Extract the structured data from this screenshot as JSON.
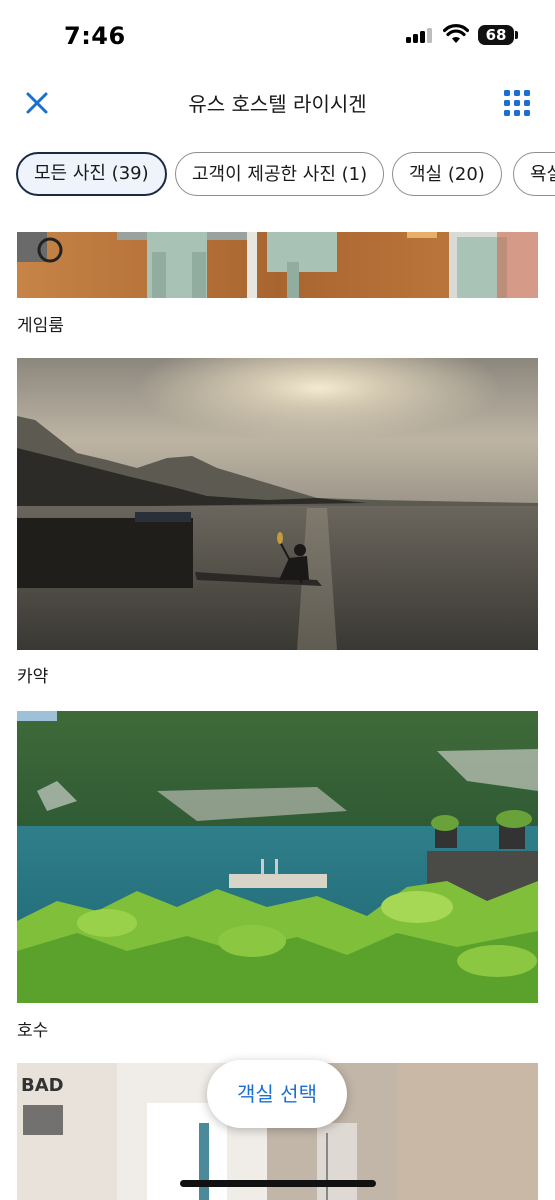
{
  "status": {
    "time": "7:46",
    "battery": "68"
  },
  "header": {
    "title": "유스 호스텔 라이시겐"
  },
  "chips": [
    {
      "label": "모든 사진 (39)"
    },
    {
      "label": "고객이 제공한 사진 (1)"
    },
    {
      "label": "객실 (20)"
    },
    {
      "label": "욕실"
    }
  ],
  "photos": [
    {
      "caption": "게임룸"
    },
    {
      "caption": "카약"
    },
    {
      "caption": "호수"
    }
  ],
  "bathroom_sign": "BAD",
  "cta": {
    "label": "객실 선택"
  },
  "colors": {
    "accent": "#1a6fd1",
    "active_chip_border": "#1b2a44",
    "active_chip_bg": "#eef3fc"
  }
}
